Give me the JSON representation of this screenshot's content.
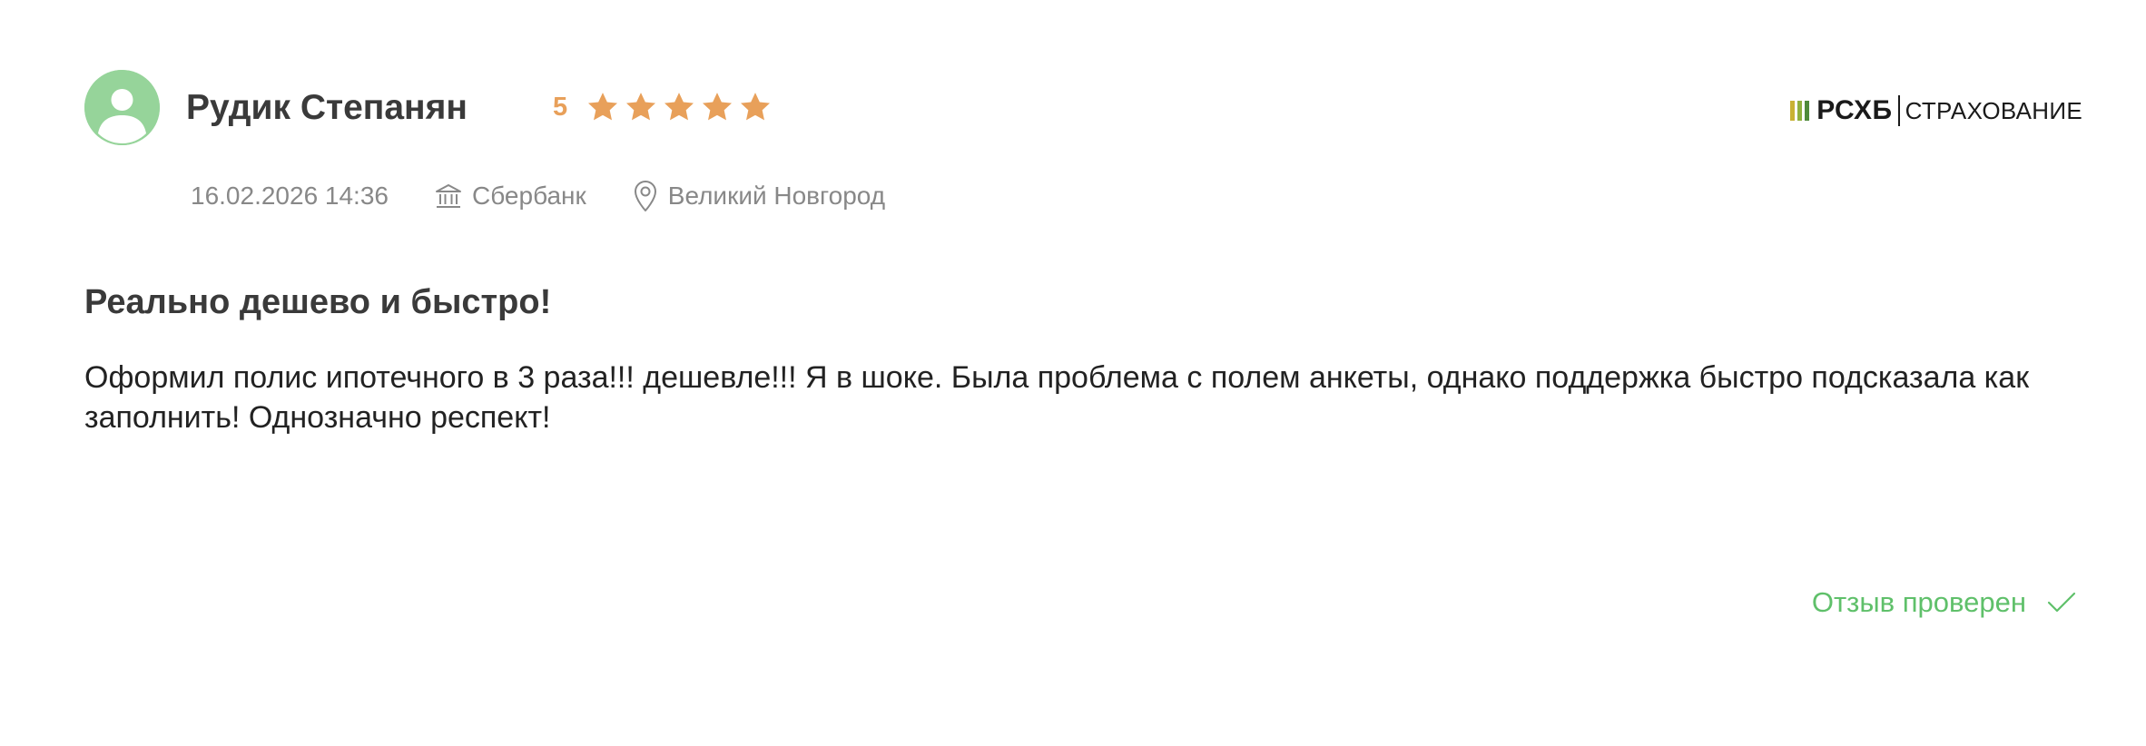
{
  "review": {
    "author": "Рудик Степанян",
    "rating": {
      "value": "5",
      "stars": 5,
      "max": 5,
      "color": "#e8a05a"
    },
    "date": "16.02.2026 14:36",
    "bank": "Сбербанк",
    "city": "Великий Новгород",
    "title": "Реально дешево и быстро!",
    "text": "Оформил полис ипотечного в 3 раза!!! дешевле!!! Я в шоке. Была проблема с полем анкеты, однако поддержка быстро подсказала как заполнить! Однозначно респект!",
    "verified_label": "Отзыв проверен"
  },
  "company_logo": {
    "brand": "РСХБ",
    "subtitle": "СТРАХОВАНИЕ",
    "bar_colors": [
      "#c9b233",
      "#8fb03e",
      "#4f8a3c"
    ]
  },
  "colors": {
    "avatar_bg": "#96d49a",
    "verified": "#5fc06a",
    "meta_text": "#888888"
  },
  "icons": {
    "avatar": "user-avatar-icon",
    "star": "star-icon",
    "bank": "bank-building-icon",
    "location": "location-pin-icon",
    "verified": "checkmark-icon"
  }
}
